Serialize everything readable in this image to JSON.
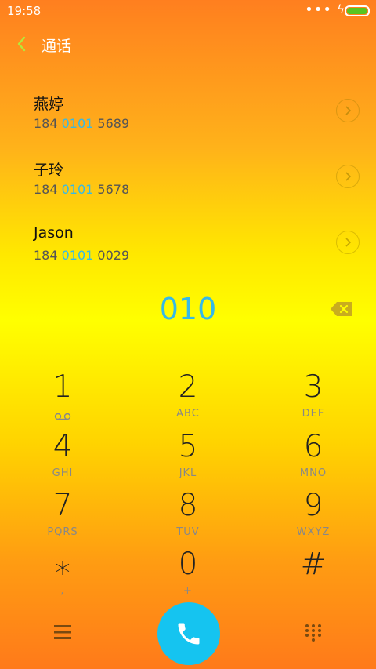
{
  "status_bar": {
    "time": "19:58",
    "dots": "•••",
    "bolt": "ϟ"
  },
  "header": {
    "title": "通话"
  },
  "suggestions": [
    {
      "name": "燕婷",
      "number_prefix": "184 ",
      "number_match": "0101",
      "number_suffix": " 5689"
    },
    {
      "name": "子玲",
      "number_prefix": "184 ",
      "number_match": "0101",
      "number_suffix": " 5678"
    },
    {
      "name": "Jason",
      "number_prefix": "184 ",
      "number_match": "0101",
      "number_suffix": " 0029"
    }
  ],
  "dialed": "010",
  "keypad": [
    {
      "digit": "1",
      "letters": "",
      "icon": "voicemail-icon"
    },
    {
      "digit": "2",
      "letters": "ABC"
    },
    {
      "digit": "3",
      "letters": "DEF"
    },
    {
      "digit": "4",
      "letters": "GHI"
    },
    {
      "digit": "5",
      "letters": "JKL"
    },
    {
      "digit": "6",
      "letters": "MNO"
    },
    {
      "digit": "7",
      "letters": "PQRS"
    },
    {
      "digit": "8",
      "letters": "TUV"
    },
    {
      "digit": "9",
      "letters": "WXYZ"
    },
    {
      "digit": "⁎",
      "letters": ","
    },
    {
      "digit": "0",
      "letters": "+"
    },
    {
      "digit": "#",
      "letters": ""
    }
  ],
  "colors": {
    "accent": "#35b9e8",
    "call_button": "#15c4f0",
    "battery": "#58c521",
    "back_arrow": "#b6e83a"
  }
}
